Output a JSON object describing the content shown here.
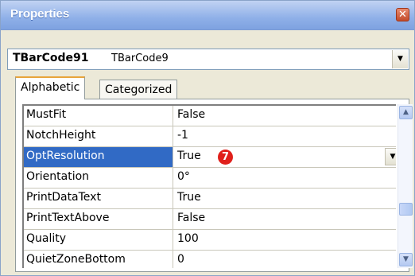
{
  "window": {
    "title": "Properties",
    "close_glyph": "✕"
  },
  "object_selector": {
    "name": "TBarCode91",
    "type": "TBarCode9"
  },
  "tabs": [
    {
      "label": "Alphabetic",
      "active": true
    },
    {
      "label": "Categorized",
      "active": false
    }
  ],
  "properties": [
    {
      "name": "MustFit",
      "value": "False"
    },
    {
      "name": "NotchHeight",
      "value": "-1"
    },
    {
      "name": "OptResolution",
      "value": "True",
      "selected": true,
      "callout": "7"
    },
    {
      "name": "Orientation",
      "value": "0°"
    },
    {
      "name": "PrintDataText",
      "value": "True"
    },
    {
      "name": "PrintTextAbove",
      "value": "False"
    },
    {
      "name": "Quality",
      "value": "100"
    },
    {
      "name": "QuietZoneBottom",
      "value": "0"
    }
  ],
  "colors": {
    "selection": "#316ac5",
    "callout": "#e0201b",
    "active_tab_accent": "#e8a53c"
  }
}
